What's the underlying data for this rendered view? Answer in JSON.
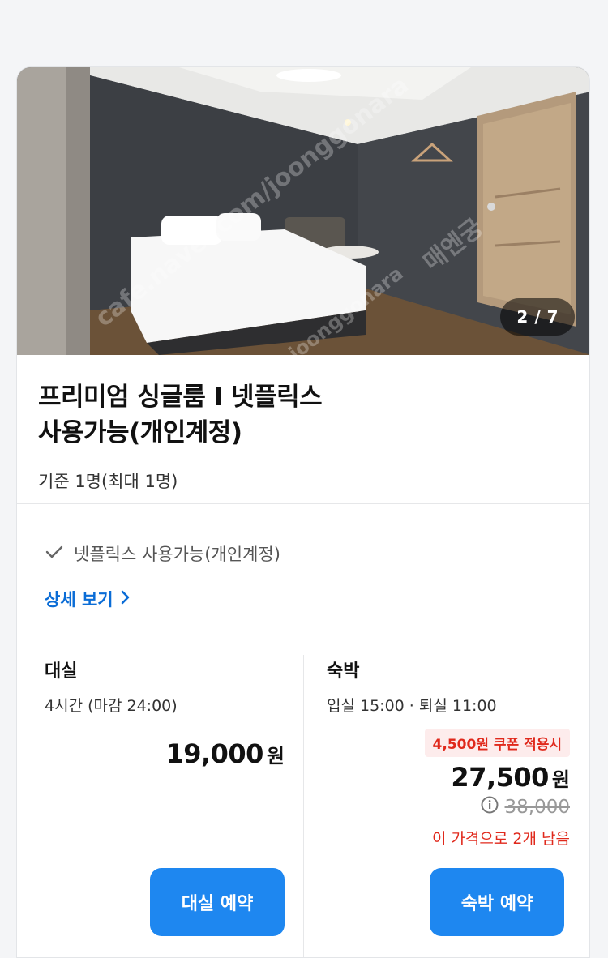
{
  "photo": {
    "counter_current": "2",
    "counter_sep": "/",
    "counter_total": "7",
    "watermarks": [
      "cafe.naver.com/joonggonara",
      "매엔궁",
      "joonggonara"
    ]
  },
  "room": {
    "title_line1": "프리미엄 싱글룸 I 넷플릭스",
    "title_line2": "사용가능(개인계정)",
    "capacity": "기준 1명(최대 1명)"
  },
  "amenity": {
    "icon": "check-icon",
    "text": "넷플릭스 사용가능(개인계정)"
  },
  "detail_link": {
    "label": "상세 보기",
    "icon": "chevron-right-icon"
  },
  "rental": {
    "title": "대실",
    "info": "4시간 (마감 24:00)",
    "price": "19,000",
    "unit": "원",
    "button": "대실 예약"
  },
  "stay": {
    "title": "숙박",
    "info": "입실 15:00 · 퇴실 11:00",
    "coupon": "4,500원 쿠폰 적용시",
    "price": "27,500",
    "unit": "원",
    "original_price": "38,000",
    "info_icon": "info-circle-icon",
    "remaining": "이 가격으로 2개 남음",
    "button": "숙박 예약"
  },
  "colors": {
    "accent": "#1e87f0",
    "link": "#0a6cd6",
    "discount": "#e0291c"
  }
}
